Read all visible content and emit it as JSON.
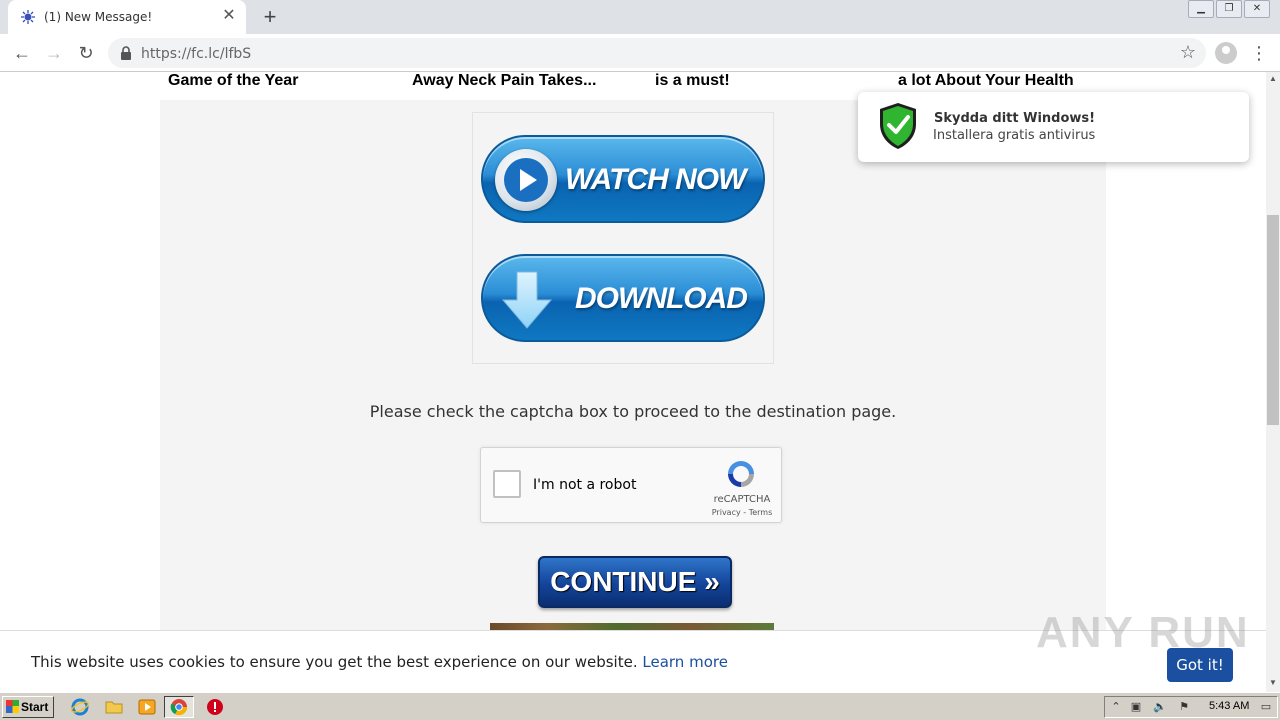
{
  "browser": {
    "tab_title": "(1) New Message!",
    "url": "https://fc.lc/lfbS"
  },
  "page": {
    "headlines": [
      "Game of the Year",
      "Away Neck Pain Takes...",
      "is a must!",
      "a lot About Your Health"
    ],
    "watch_label": "WATCH NOW",
    "download_label": "DOWNLOAD",
    "instruction": "Please check the captcha box to proceed to the destination page.",
    "recaptcha": {
      "label": "I'm not a robot",
      "brand": "reCAPTCHA",
      "links": "Privacy - Terms"
    },
    "continue_label": "CONTINUE »"
  },
  "toast": {
    "title": "Skydda ditt Windows!",
    "subtitle": "Installera gratis antivirus"
  },
  "cookie": {
    "text": "This website uses cookies to ensure you get the best experience on our website.",
    "link": "Learn more",
    "button": "Got it!"
  },
  "watermark": "ANY RUN",
  "taskbar": {
    "start_label": "Start",
    "clock": "5:43 AM"
  },
  "colors": {
    "accent_blue": "#1b4fa0",
    "button_blue": "#0f78c2",
    "shield_green": "#2fb52f"
  }
}
